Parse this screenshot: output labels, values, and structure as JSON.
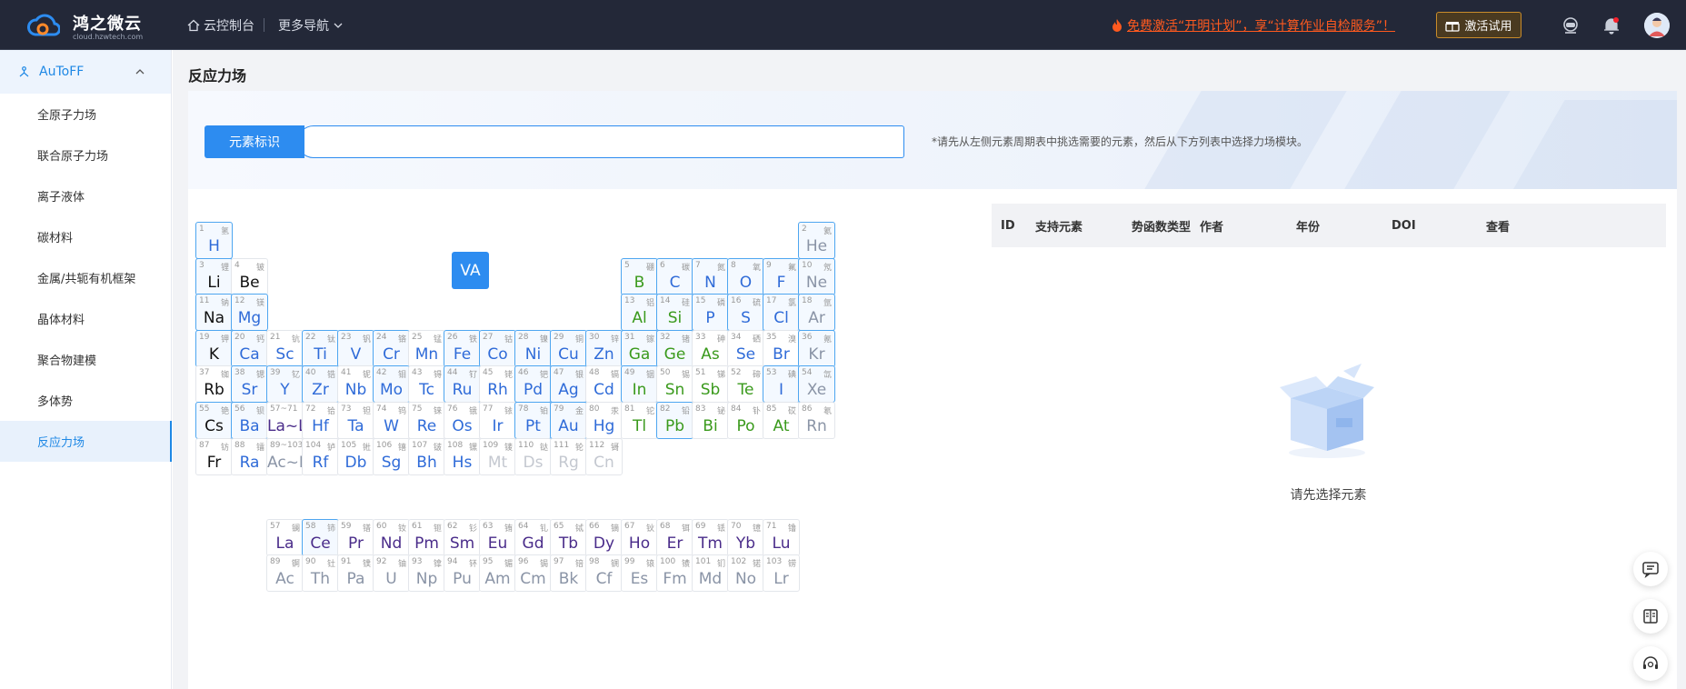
{
  "brand": {
    "name": "鸿之微云",
    "url": "cloud.hzwtech.com"
  },
  "topnav": {
    "console": "云控制台",
    "more_nav": "更多导航"
  },
  "promo": {
    "text": "免费激活“开明计划”，享“计算作业自检服务”！"
  },
  "activate_button": "激活试用",
  "sidebar": {
    "parent": "AuToFF",
    "items": [
      {
        "label": "全原子力场"
      },
      {
        "label": "联合原子力场"
      },
      {
        "label": "离子液体"
      },
      {
        "label": "碳材料"
      },
      {
        "label": "金属/共轭有机框架"
      },
      {
        "label": "晶体材料"
      },
      {
        "label": "聚合物建模"
      },
      {
        "label": "多体势"
      },
      {
        "label": "反应力场",
        "active": true
      }
    ]
  },
  "page_title": "反应力场",
  "search": {
    "label": "元素标识",
    "value": "",
    "placeholder": "",
    "hint": "*请先从左侧元素周期表中挑选需要的元素，然后从下方列表中选择力场模块。"
  },
  "group_label": "VA",
  "table": {
    "columns": [
      "ID",
      "支持元素",
      "势函数类型",
      "作者",
      "年份",
      "DOI",
      "查看"
    ],
    "empty_text": "请先选择元素"
  },
  "elements": [
    {
      "num": "1",
      "cn": "氢",
      "sym": "H",
      "c": "blue",
      "sel": true,
      "r": 0,
      "col": 0
    },
    {
      "num": "2",
      "cn": "氦",
      "sym": "He",
      "c": "gray",
      "sel": true,
      "r": 0,
      "col": 17
    },
    {
      "num": "3",
      "cn": "锂",
      "sym": "Li",
      "c": "black",
      "sel": true,
      "r": 1,
      "col": 0
    },
    {
      "num": "4",
      "cn": "铍",
      "sym": "Be",
      "c": "black",
      "sel": false,
      "r": 1,
      "col": 1
    },
    {
      "num": "5",
      "cn": "硼",
      "sym": "B",
      "c": "green",
      "sel": true,
      "r": 1,
      "col": 12
    },
    {
      "num": "6",
      "cn": "碳",
      "sym": "C",
      "c": "blue",
      "sel": true,
      "r": 1,
      "col": 13
    },
    {
      "num": "7",
      "cn": "氮",
      "sym": "N",
      "c": "blue",
      "sel": true,
      "r": 1,
      "col": 14
    },
    {
      "num": "8",
      "cn": "氧",
      "sym": "O",
      "c": "blue",
      "sel": true,
      "r": 1,
      "col": 15
    },
    {
      "num": "9",
      "cn": "氟",
      "sym": "F",
      "c": "blue",
      "sel": true,
      "r": 1,
      "col": 16
    },
    {
      "num": "10",
      "cn": "氖",
      "sym": "Ne",
      "c": "gray",
      "sel": true,
      "r": 1,
      "col": 17
    },
    {
      "num": "11",
      "cn": "钠",
      "sym": "Na",
      "c": "black",
      "sel": true,
      "r": 2,
      "col": 0
    },
    {
      "num": "12",
      "cn": "镁",
      "sym": "Mg",
      "c": "blue",
      "sel": true,
      "r": 2,
      "col": 1
    },
    {
      "num": "13",
      "cn": "铝",
      "sym": "Al",
      "c": "green",
      "sel": true,
      "r": 2,
      "col": 12
    },
    {
      "num": "14",
      "cn": "硅",
      "sym": "Si",
      "c": "green",
      "sel": true,
      "r": 2,
      "col": 13
    },
    {
      "num": "15",
      "cn": "磷",
      "sym": "P",
      "c": "blue",
      "sel": true,
      "r": 2,
      "col": 14
    },
    {
      "num": "16",
      "cn": "硫",
      "sym": "S",
      "c": "blue",
      "sel": true,
      "r": 2,
      "col": 15
    },
    {
      "num": "17",
      "cn": "氯",
      "sym": "Cl",
      "c": "blue",
      "sel": true,
      "r": 2,
      "col": 16
    },
    {
      "num": "18",
      "cn": "氩",
      "sym": "Ar",
      "c": "gray",
      "sel": true,
      "r": 2,
      "col": 17
    },
    {
      "num": "19",
      "cn": "钾",
      "sym": "K",
      "c": "black",
      "sel": true,
      "r": 3,
      "col": 0
    },
    {
      "num": "20",
      "cn": "钙",
      "sym": "Ca",
      "c": "blue",
      "sel": true,
      "r": 3,
      "col": 1
    },
    {
      "num": "21",
      "cn": "钪",
      "sym": "Sc",
      "c": "blue",
      "sel": false,
      "r": 3,
      "col": 2
    },
    {
      "num": "22",
      "cn": "钛",
      "sym": "Ti",
      "c": "blue",
      "sel": true,
      "r": 3,
      "col": 3
    },
    {
      "num": "23",
      "cn": "钒",
      "sym": "V",
      "c": "blue",
      "sel": true,
      "r": 3,
      "col": 4
    },
    {
      "num": "24",
      "cn": "铬",
      "sym": "Cr",
      "c": "blue",
      "sel": true,
      "r": 3,
      "col": 5
    },
    {
      "num": "25",
      "cn": "锰",
      "sym": "Mn",
      "c": "blue",
      "sel": false,
      "r": 3,
      "col": 6
    },
    {
      "num": "26",
      "cn": "铁",
      "sym": "Fe",
      "c": "blue",
      "sel": true,
      "r": 3,
      "col": 7
    },
    {
      "num": "27",
      "cn": "钴",
      "sym": "Co",
      "c": "blue",
      "sel": true,
      "r": 3,
      "col": 8
    },
    {
      "num": "28",
      "cn": "镍",
      "sym": "Ni",
      "c": "blue",
      "sel": true,
      "r": 3,
      "col": 9
    },
    {
      "num": "29",
      "cn": "铜",
      "sym": "Cu",
      "c": "blue",
      "sel": true,
      "r": 3,
      "col": 10
    },
    {
      "num": "30",
      "cn": "锌",
      "sym": "Zn",
      "c": "blue",
      "sel": true,
      "r": 3,
      "col": 11
    },
    {
      "num": "31",
      "cn": "镓",
      "sym": "Ga",
      "c": "green",
      "sel": true,
      "r": 3,
      "col": 12
    },
    {
      "num": "32",
      "cn": "锗",
      "sym": "Ge",
      "c": "green",
      "sel": true,
      "r": 3,
      "col": 13
    },
    {
      "num": "33",
      "cn": "砷",
      "sym": "As",
      "c": "green",
      "sel": false,
      "r": 3,
      "col": 14
    },
    {
      "num": "34",
      "cn": "硒",
      "sym": "Se",
      "c": "blue",
      "sel": false,
      "r": 3,
      "col": 15
    },
    {
      "num": "35",
      "cn": "溴",
      "sym": "Br",
      "c": "blue",
      "sel": false,
      "r": 3,
      "col": 16
    },
    {
      "num": "36",
      "cn": "氪",
      "sym": "Kr",
      "c": "gray",
      "sel": true,
      "r": 3,
      "col": 17
    },
    {
      "num": "37",
      "cn": "铷",
      "sym": "Rb",
      "c": "black",
      "sel": false,
      "r": 4,
      "col": 0
    },
    {
      "num": "38",
      "cn": "锶",
      "sym": "Sr",
      "c": "blue",
      "sel": true,
      "r": 4,
      "col": 1
    },
    {
      "num": "39",
      "cn": "钇",
      "sym": "Y",
      "c": "blue",
      "sel": true,
      "r": 4,
      "col": 2
    },
    {
      "num": "40",
      "cn": "锆",
      "sym": "Zr",
      "c": "blue",
      "sel": true,
      "r": 4,
      "col": 3
    },
    {
      "num": "41",
      "cn": "铌",
      "sym": "Nb",
      "c": "blue",
      "sel": false,
      "r": 4,
      "col": 4
    },
    {
      "num": "42",
      "cn": "钼",
      "sym": "Mo",
      "c": "blue",
      "sel": true,
      "r": 4,
      "col": 5
    },
    {
      "num": "43",
      "cn": "锝",
      "sym": "Tc",
      "c": "blue",
      "sel": false,
      "r": 4,
      "col": 6
    },
    {
      "num": "44",
      "cn": "钌",
      "sym": "Ru",
      "c": "blue",
      "sel": true,
      "r": 4,
      "col": 7
    },
    {
      "num": "45",
      "cn": "铑",
      "sym": "Rh",
      "c": "blue",
      "sel": false,
      "r": 4,
      "col": 8
    },
    {
      "num": "46",
      "cn": "钯",
      "sym": "Pd",
      "c": "blue",
      "sel": true,
      "r": 4,
      "col": 9
    },
    {
      "num": "47",
      "cn": "银",
      "sym": "Ag",
      "c": "blue",
      "sel": true,
      "r": 4,
      "col": 10
    },
    {
      "num": "48",
      "cn": "镉",
      "sym": "Cd",
      "c": "blue",
      "sel": false,
      "r": 4,
      "col": 11
    },
    {
      "num": "49",
      "cn": "铟",
      "sym": "In",
      "c": "green",
      "sel": true,
      "r": 4,
      "col": 12
    },
    {
      "num": "50",
      "cn": "锡",
      "sym": "Sn",
      "c": "green",
      "sel": false,
      "r": 4,
      "col": 13
    },
    {
      "num": "51",
      "cn": "锑",
      "sym": "Sb",
      "c": "green",
      "sel": false,
      "r": 4,
      "col": 14
    },
    {
      "num": "52",
      "cn": "碲",
      "sym": "Te",
      "c": "green",
      "sel": false,
      "r": 4,
      "col": 15
    },
    {
      "num": "53",
      "cn": "碘",
      "sym": "I",
      "c": "blue",
      "sel": true,
      "r": 4,
      "col": 16
    },
    {
      "num": "54",
      "cn": "氙",
      "sym": "Xe",
      "c": "gray",
      "sel": true,
      "r": 4,
      "col": 17
    },
    {
      "num": "55",
      "cn": "铯",
      "sym": "Cs",
      "c": "black",
      "sel": true,
      "r": 5,
      "col": 0
    },
    {
      "num": "56",
      "cn": "钡",
      "sym": "Ba",
      "c": "blue",
      "sel": true,
      "r": 5,
      "col": 1
    },
    {
      "num": "57~71",
      "cn": "",
      "sym": "La~Lu",
      "c": "purple",
      "sel": false,
      "r": 5,
      "col": 2
    },
    {
      "num": "72",
      "cn": "铪",
      "sym": "Hf",
      "c": "blue",
      "sel": false,
      "r": 5,
      "col": 3
    },
    {
      "num": "73",
      "cn": "钽",
      "sym": "Ta",
      "c": "blue",
      "sel": false,
      "r": 5,
      "col": 4
    },
    {
      "num": "74",
      "cn": "钨",
      "sym": "W",
      "c": "blue",
      "sel": false,
      "r": 5,
      "col": 5
    },
    {
      "num": "75",
      "cn": "铼",
      "sym": "Re",
      "c": "blue",
      "sel": false,
      "r": 5,
      "col": 6
    },
    {
      "num": "76",
      "cn": "锇",
      "sym": "Os",
      "c": "blue",
      "sel": false,
      "r": 5,
      "col": 7
    },
    {
      "num": "77",
      "cn": "铱",
      "sym": "Ir",
      "c": "blue",
      "sel": false,
      "r": 5,
      "col": 8
    },
    {
      "num": "78",
      "cn": "铂",
      "sym": "Pt",
      "c": "blue",
      "sel": true,
      "r": 5,
      "col": 9
    },
    {
      "num": "79",
      "cn": "金",
      "sym": "Au",
      "c": "blue",
      "sel": true,
      "r": 5,
      "col": 10
    },
    {
      "num": "80",
      "cn": "汞",
      "sym": "Hg",
      "c": "blue",
      "sel": false,
      "r": 5,
      "col": 11
    },
    {
      "num": "81",
      "cn": "铊",
      "sym": "Tl",
      "c": "green",
      "sel": false,
      "r": 5,
      "col": 12
    },
    {
      "num": "82",
      "cn": "铅",
      "sym": "Pb",
      "c": "green",
      "sel": true,
      "r": 5,
      "col": 13
    },
    {
      "num": "83",
      "cn": "铋",
      "sym": "Bi",
      "c": "green",
      "sel": false,
      "r": 5,
      "col": 14
    },
    {
      "num": "84",
      "cn": "钋",
      "sym": "Po",
      "c": "green",
      "sel": false,
      "r": 5,
      "col": 15
    },
    {
      "num": "85",
      "cn": "砹",
      "sym": "At",
      "c": "green",
      "sel": false,
      "r": 5,
      "col": 16
    },
    {
      "num": "86",
      "cn": "氡",
      "sym": "Rn",
      "c": "gray",
      "sel": false,
      "r": 5,
      "col": 17
    },
    {
      "num": "87",
      "cn": "钫",
      "sym": "Fr",
      "c": "black",
      "sel": false,
      "r": 6,
      "col": 0
    },
    {
      "num": "88",
      "cn": "镭",
      "sym": "Ra",
      "c": "blue",
      "sel": false,
      "r": 6,
      "col": 1
    },
    {
      "num": "89~103",
      "cn": "",
      "sym": "Ac~Lr",
      "c": "gray",
      "sel": false,
      "r": 6,
      "col": 2
    },
    {
      "num": "104",
      "cn": "𬬻",
      "sym": "Rf",
      "c": "blue",
      "sel": false,
      "r": 6,
      "col": 3
    },
    {
      "num": "105",
      "cn": "𬭊",
      "sym": "Db",
      "c": "blue",
      "sel": false,
      "r": 6,
      "col": 4
    },
    {
      "num": "106",
      "cn": "𬭳",
      "sym": "Sg",
      "c": "blue",
      "sel": false,
      "r": 6,
      "col": 5
    },
    {
      "num": "107",
      "cn": "𬭛",
      "sym": "Bh",
      "c": "blue",
      "sel": false,
      "r": 6,
      "col": 6
    },
    {
      "num": "108",
      "cn": "𬭶",
      "sym": "Hs",
      "c": "blue",
      "sel": false,
      "r": 6,
      "col": 7
    },
    {
      "num": "109",
      "cn": "鿏",
      "sym": "Mt",
      "c": "light",
      "sel": false,
      "r": 6,
      "col": 8
    },
    {
      "num": "110",
      "cn": "𫟼",
      "sym": "Ds",
      "c": "light",
      "sel": false,
      "r": 6,
      "col": 9
    },
    {
      "num": "111",
      "cn": "𬬭",
      "sym": "Rg",
      "c": "light",
      "sel": false,
      "r": 6,
      "col": 10
    },
    {
      "num": "112",
      "cn": "鿔",
      "sym": "Cn",
      "c": "light",
      "sel": false,
      "r": 6,
      "col": 11
    },
    {
      "num": "57",
      "cn": "镧",
      "sym": "La",
      "c": "purple",
      "sel": false,
      "r": 8,
      "col": 2
    },
    {
      "num": "58",
      "cn": "铈",
      "sym": "Ce",
      "c": "purple",
      "sel": true,
      "r": 8,
      "col": 3
    },
    {
      "num": "59",
      "cn": "镨",
      "sym": "Pr",
      "c": "purple",
      "sel": false,
      "r": 8,
      "col": 4
    },
    {
      "num": "60",
      "cn": "钕",
      "sym": "Nd",
      "c": "purple",
      "sel": false,
      "r": 8,
      "col": 5
    },
    {
      "num": "61",
      "cn": "钷",
      "sym": "Pm",
      "c": "purple",
      "sel": false,
      "r": 8,
      "col": 6
    },
    {
      "num": "62",
      "cn": "钐",
      "sym": "Sm",
      "c": "purple",
      "sel": false,
      "r": 8,
      "col": 7
    },
    {
      "num": "63",
      "cn": "铕",
      "sym": "Eu",
      "c": "purple",
      "sel": false,
      "r": 8,
      "col": 8
    },
    {
      "num": "64",
      "cn": "钆",
      "sym": "Gd",
      "c": "purple",
      "sel": false,
      "r": 8,
      "col": 9
    },
    {
      "num": "65",
      "cn": "铽",
      "sym": "Tb",
      "c": "purple",
      "sel": false,
      "r": 8,
      "col": 10
    },
    {
      "num": "66",
      "cn": "镝",
      "sym": "Dy",
      "c": "purple",
      "sel": false,
      "r": 8,
      "col": 11
    },
    {
      "num": "67",
      "cn": "钬",
      "sym": "Ho",
      "c": "purple",
      "sel": false,
      "r": 8,
      "col": 12
    },
    {
      "num": "68",
      "cn": "铒",
      "sym": "Er",
      "c": "purple",
      "sel": false,
      "r": 8,
      "col": 13
    },
    {
      "num": "69",
      "cn": "铥",
      "sym": "Tm",
      "c": "purple",
      "sel": false,
      "r": 8,
      "col": 14
    },
    {
      "num": "70",
      "cn": "镱",
      "sym": "Yb",
      "c": "purple",
      "sel": false,
      "r": 8,
      "col": 15
    },
    {
      "num": "71",
      "cn": "镥",
      "sym": "Lu",
      "c": "purple",
      "sel": false,
      "r": 8,
      "col": 16
    },
    {
      "num": "89",
      "cn": "锕",
      "sym": "Ac",
      "c": "gray",
      "sel": false,
      "r": 9,
      "col": 2
    },
    {
      "num": "90",
      "cn": "钍",
      "sym": "Th",
      "c": "gray",
      "sel": false,
      "r": 9,
      "col": 3
    },
    {
      "num": "91",
      "cn": "镤",
      "sym": "Pa",
      "c": "gray",
      "sel": false,
      "r": 9,
      "col": 4
    },
    {
      "num": "92",
      "cn": "铀",
      "sym": "U",
      "c": "gray",
      "sel": false,
      "r": 9,
      "col": 5
    },
    {
      "num": "93",
      "cn": "镎",
      "sym": "Np",
      "c": "gray",
      "sel": false,
      "r": 9,
      "col": 6
    },
    {
      "num": "94",
      "cn": "钚",
      "sym": "Pu",
      "c": "gray",
      "sel": false,
      "r": 9,
      "col": 7
    },
    {
      "num": "95",
      "cn": "镅",
      "sym": "Am",
      "c": "gray",
      "sel": false,
      "r": 9,
      "col": 8
    },
    {
      "num": "96",
      "cn": "锔",
      "sym": "Cm",
      "c": "gray",
      "sel": false,
      "r": 9,
      "col": 9
    },
    {
      "num": "97",
      "cn": "锫",
      "sym": "Bk",
      "c": "gray",
      "sel": false,
      "r": 9,
      "col": 10
    },
    {
      "num": "98",
      "cn": "锎",
      "sym": "Cf",
      "c": "gray",
      "sel": false,
      "r": 9,
      "col": 11
    },
    {
      "num": "99",
      "cn": "锿",
      "sym": "Es",
      "c": "gray",
      "sel": false,
      "r": 9,
      "col": 12
    },
    {
      "num": "100",
      "cn": "镄",
      "sym": "Fm",
      "c": "gray",
      "sel": false,
      "r": 9,
      "col": 13
    },
    {
      "num": "101",
      "cn": "钔",
      "sym": "Md",
      "c": "gray",
      "sel": false,
      "r": 9,
      "col": 14
    },
    {
      "num": "102",
      "cn": "锘",
      "sym": "No",
      "c": "gray",
      "sel": false,
      "r": 9,
      "col": 15
    },
    {
      "num": "103",
      "cn": "铹",
      "sym": "Lr",
      "c": "gray",
      "sel": false,
      "r": 9,
      "col": 16
    }
  ],
  "colors": {
    "topbar": "#232838",
    "accent": "#2d8cf0",
    "promo": "#ff5a1f",
    "sidebar_active_bg": "#e8f1fc"
  },
  "icons": [
    "cloud-logo-icon",
    "home-icon",
    "chevron-down-icon",
    "fire-icon",
    "gift-icon",
    "robot-icon",
    "bell-icon",
    "user-avatar-icon",
    "network-icon",
    "chevron-up-icon",
    "empty-box-icon",
    "message-icon",
    "book-icon",
    "headset-icon"
  ]
}
